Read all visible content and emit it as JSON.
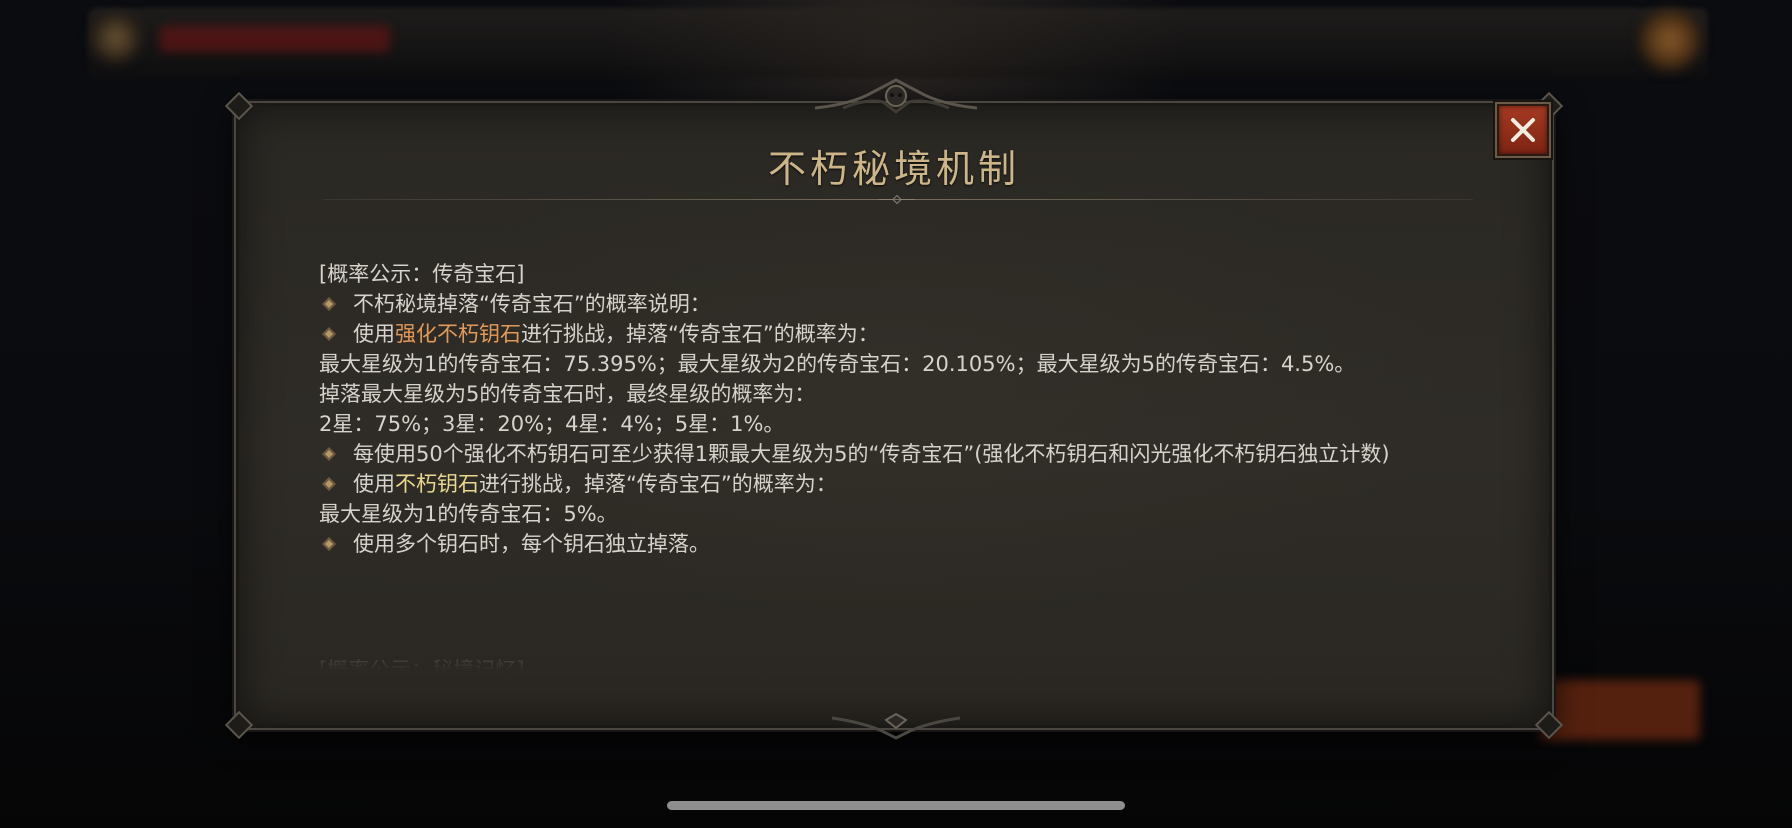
{
  "dialog": {
    "title": "不朽秘境机制",
    "section_heading": "[概率公示：传奇宝石]",
    "lines": {
      "l1": "不朽秘境掉落“传奇宝石”的概率说明：",
      "l2_pre": "使用",
      "l2_highlight": "强化不朽钥石",
      "l2_post": "进行挑战，掉落“传奇宝石”的概率为：",
      "l3": "最大星级为1的传奇宝石：75.395%；最大星级为2的传奇宝石：20.105%；最大星级为5的传奇宝石：4.5%。",
      "l4": "掉落最大星级为5的传奇宝石时，最终星级的概率为：",
      "l5": "2星：75%；3星：20%；4星：4%；5星：1%。",
      "l6": "每使用50个强化不朽钥石可至少获得1颗最大星级为5的“传奇宝石”(强化不朽钥石和闪光强化不朽钥石独立计数)",
      "l7_pre": "使用",
      "l7_highlight": "不朽钥石",
      "l7_post": "进行挑战，掉落“传奇宝石”的概率为：",
      "l8": "最大星级为1的传奇宝石：5%。",
      "l9": "使用多个钥石时，每个钥石独立掉落。"
    },
    "next_section_heading_partial": "[概率公示：秘境记忆]"
  },
  "colors": {
    "title_gold": "#cdb58a",
    "highlight_orange": "#e29a5a",
    "highlight_yellow": "#e8d890",
    "close_red": "#a53a22",
    "body_text": "#d6d3cc"
  },
  "icons": {
    "bullet": "diamond-bullet-icon",
    "close": "close-x-icon"
  }
}
